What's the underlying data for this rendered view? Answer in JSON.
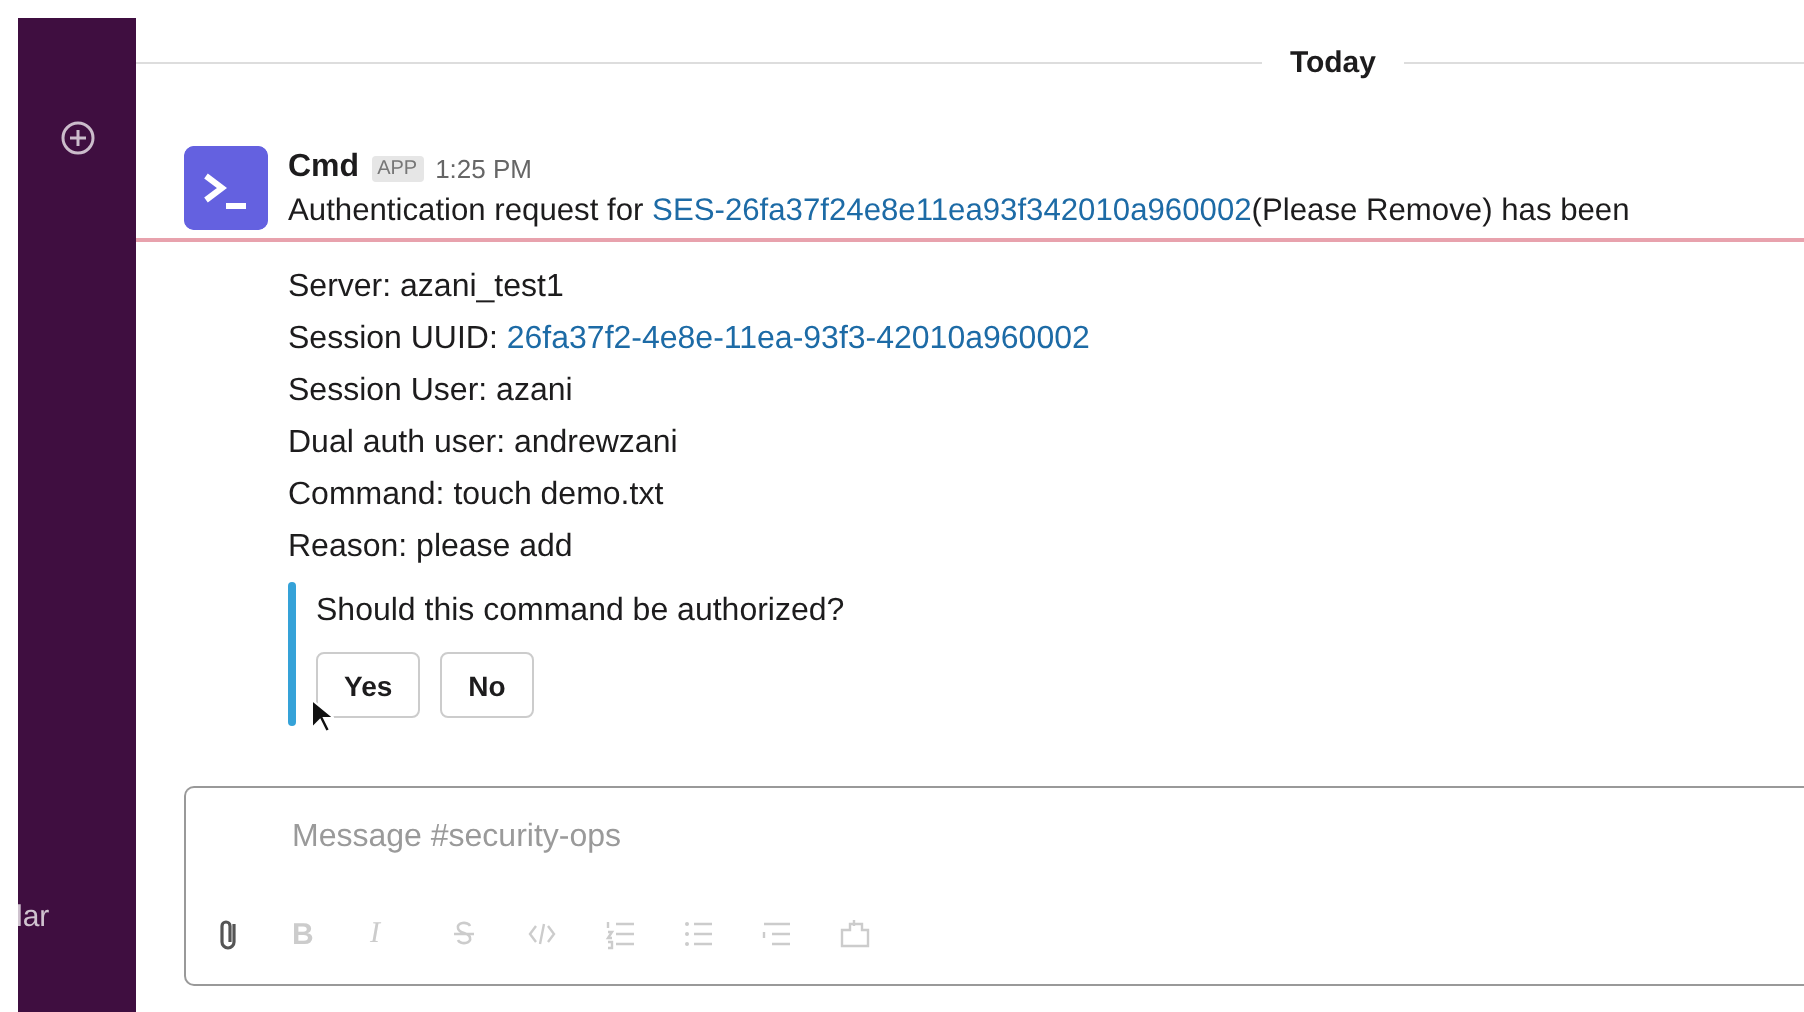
{
  "sidebar": {
    "label": "lar"
  },
  "day_divider": {
    "label": "Today"
  },
  "message": {
    "sender": "Cmd",
    "badge": "APP",
    "time": "1:25 PM",
    "text": "Authentication request for ",
    "link": "SES-26fa37f24e8e11ea93f342010a960002",
    "text_after": "(Please Remove) has been",
    "details": [
      {
        "text": "Server: azani_test1"
      },
      {
        "text": "Session UUID: ",
        "link": "26fa37f2-4e8e-11ea-93f3-42010a960002"
      },
      {
        "text": "Session User: azani"
      },
      {
        "text": "Dual auth user: andrewzani"
      },
      {
        "text": "Command: touch demo.txt"
      },
      {
        "text": "Reason: please add"
      }
    ],
    "attachment": {
      "question": "Should this command be authorized?",
      "buttons": [
        "Yes",
        "No"
      ]
    }
  },
  "composer": {
    "placeholder": "Message #security-ops",
    "toolbar": [
      {
        "kind": "attach",
        "disabled": false
      },
      {
        "kind": "bold",
        "label": "B",
        "disabled": true
      },
      {
        "kind": "italic",
        "label": "I",
        "disabled": true
      },
      {
        "kind": "strike",
        "disabled": true
      },
      {
        "kind": "code",
        "disabled": true
      },
      {
        "kind": "ordered-list",
        "disabled": true
      },
      {
        "kind": "bullet-list",
        "disabled": true
      },
      {
        "kind": "indent",
        "disabled": true
      },
      {
        "kind": "snippet",
        "disabled": true
      }
    ]
  }
}
